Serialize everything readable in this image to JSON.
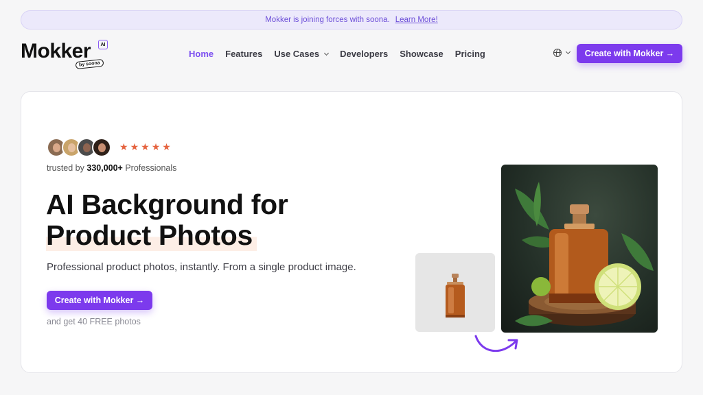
{
  "banner": {
    "text": "Mokker is joining forces with soona.",
    "link": "Learn More!"
  },
  "logo": {
    "name": "Mokker",
    "badge": "AI",
    "tag": "by soona"
  },
  "nav": {
    "items": [
      {
        "label": "Home",
        "active": true
      },
      {
        "label": "Features"
      },
      {
        "label": "Use Cases",
        "dropdown": true
      },
      {
        "label": "Developers"
      },
      {
        "label": "Showcase"
      },
      {
        "label": "Pricing"
      }
    ],
    "cta": "Create with Mokker →"
  },
  "hero": {
    "rating_stars": 5,
    "trusted_prefix": "trusted by",
    "trusted_count": "330,000+",
    "trusted_suffix": "Professionals",
    "headline_line1": "AI Background for",
    "headline_line2": "Product Photos",
    "subhead": "Professional product photos, instantly. From a single product image.",
    "cta": "Create with Mokker →",
    "free_note": "and get 40 FREE photos"
  },
  "colors": {
    "accent": "#7c3aed",
    "star": "#e5633f",
    "highlight": "#fdeee6"
  }
}
